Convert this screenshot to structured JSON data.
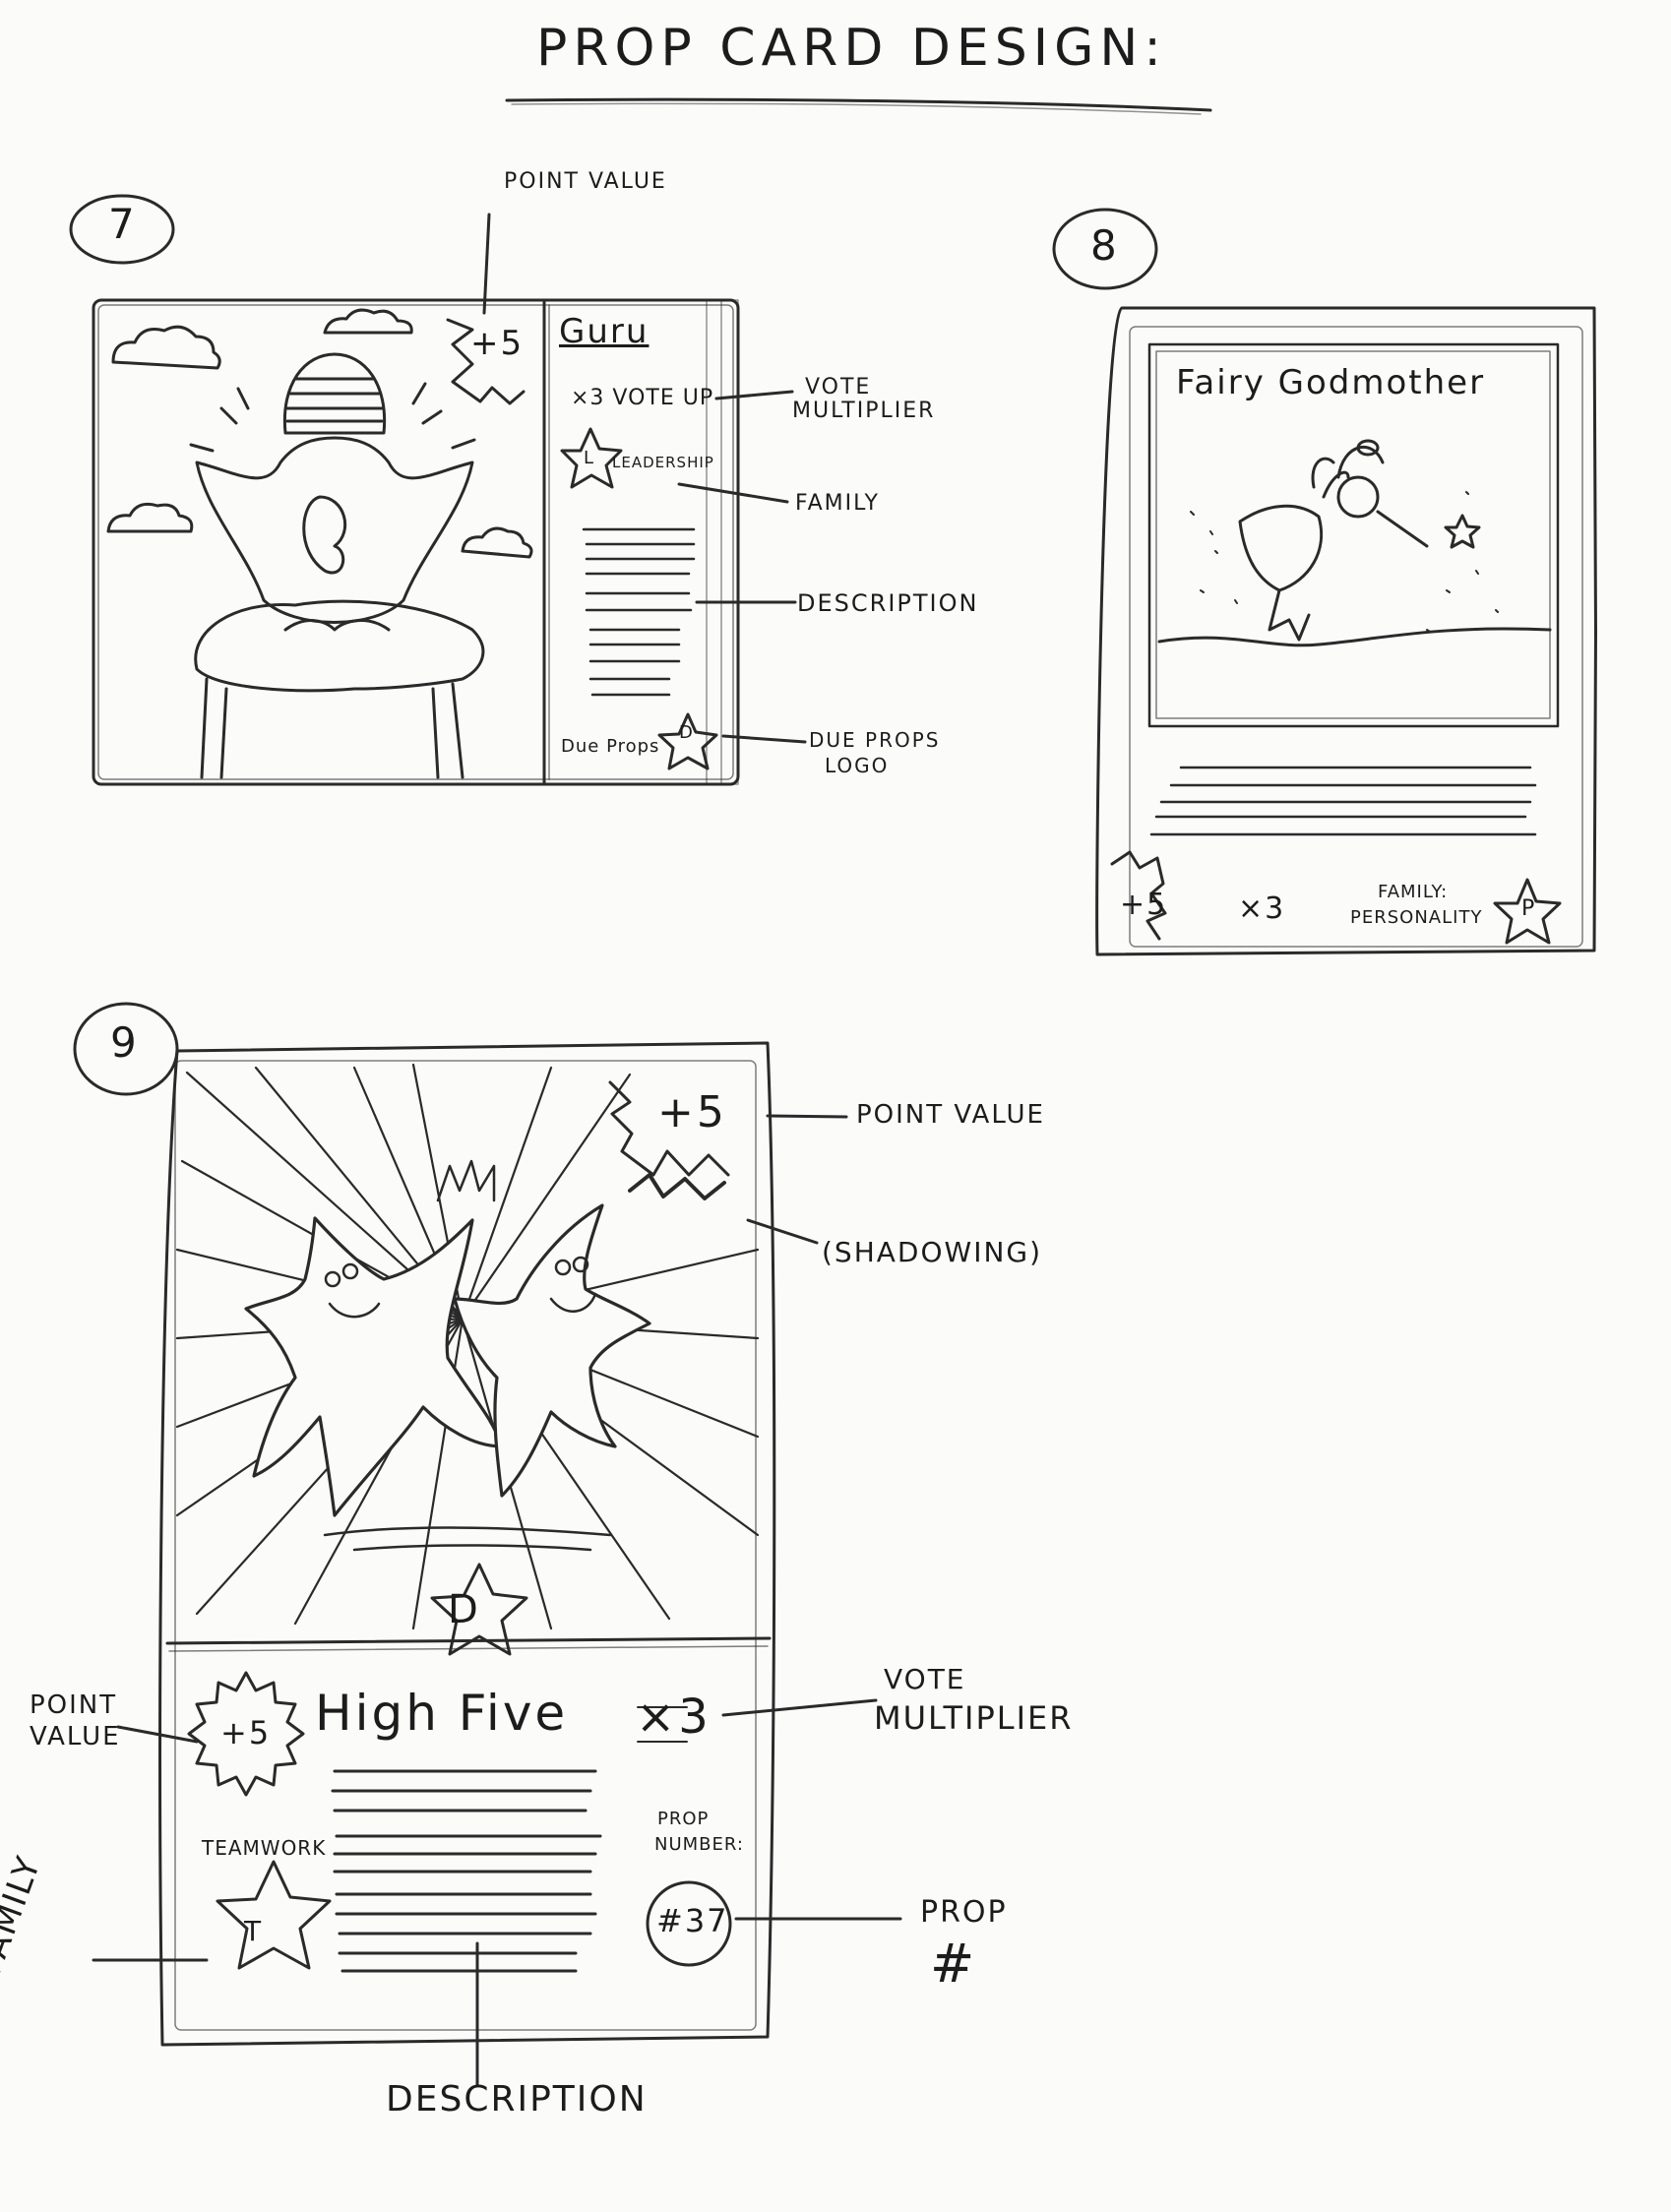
{
  "title": "PROP CARD DESIGN:",
  "sketch7": {
    "number": "7",
    "card_name": "Guru",
    "points": "+5",
    "multiplier": "×3 VOTE UP",
    "family_letter": "L",
    "family_name": "LEADERSHIP",
    "brand": "Due Props",
    "logo_letter": "D",
    "labels": {
      "point_value": "POINT VALUE",
      "vote_multiplier_1": "VOTE",
      "vote_multiplier_2": "MULTIPLIER",
      "family": "FAMILY",
      "description": "DESCRIPTION",
      "logo_1": "DUE PROPS",
      "logo_2": "LOGO"
    }
  },
  "sketch8": {
    "number": "8",
    "card_name": "Fairy Godmother",
    "points": "+5",
    "multiplier": "×3",
    "family_label_1": "FAMILY:",
    "family_label_2": "PERSONALITY",
    "family_letter": "P"
  },
  "sketch9": {
    "number": "9",
    "card_name": "High Five",
    "points_top": "+5",
    "points_badge": "+5",
    "multiplier": "×3",
    "logo_letter": "D",
    "family_name": "TEAMWORK",
    "family_letter": "T",
    "prop_number_label_1": "PROP",
    "prop_number_label_2": "NUMBER:",
    "prop_number": "#37",
    "labels": {
      "point_value_top": "POINT VALUE",
      "shadowing": "(SHADOWING)",
      "point_value_left_1": "POINT",
      "point_value_left_2": "VALUE",
      "vote_multiplier_1": "VOTE",
      "vote_multiplier_2": "MULTIPLIER",
      "prop_1": "PROP",
      "prop_2": "#",
      "family": "FAMILY",
      "description": "DESCRIPTION"
    }
  }
}
